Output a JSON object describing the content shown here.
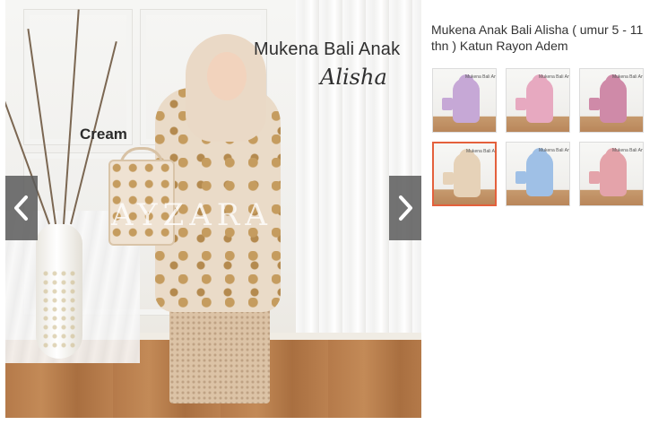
{
  "main_image": {
    "title_line1": "Mukena Bali Anak",
    "title_line2": "Alisha",
    "color_name": "Cream",
    "watermark": "AYZARA"
  },
  "nav": {
    "prev_icon": "chevron-left-icon",
    "next_icon": "chevron-right-icon"
  },
  "product": {
    "name": "Mukena Anak Bali Alisha ( umur 5 - 11 thn ) Katun Rayon Adem"
  },
  "thumbnails": [
    {
      "color": "#c6a8d6",
      "label": "Mukena Bali Anak",
      "selected": false
    },
    {
      "color": "#e7a9c0",
      "label": "Mukena Bali Anak",
      "selected": false
    },
    {
      "color": "#cf8aa8",
      "label": "Mukena Bali Anak",
      "selected": false
    },
    {
      "color": "#e6d2b8",
      "label": "Mukena Bali Anak",
      "selected": true
    },
    {
      "color": "#9fc0e6",
      "label": "Mukena Bali Anak",
      "selected": false
    },
    {
      "color": "#e4a3aa",
      "label": "Mukena Bali Anak",
      "selected": false
    }
  ],
  "colors": {
    "selected_border": "#e4603c",
    "nav_bg": "#5a5a5a"
  }
}
